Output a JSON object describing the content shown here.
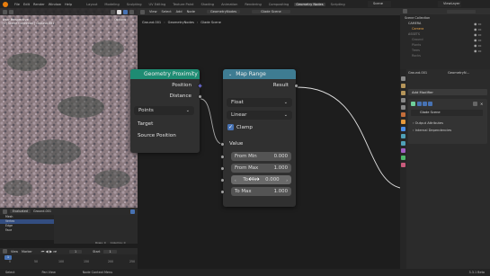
{
  "topbar": {
    "menus": [
      "File",
      "Edit",
      "Render",
      "Window",
      "Help"
    ],
    "workspaces": [
      "Layout",
      "Modeling",
      "Sculpting",
      "UV Editing",
      "Texture Paint",
      "Shading",
      "Animation",
      "Rendering",
      "Compositing",
      "Geometry Nodes",
      "Scripting"
    ],
    "active_workspace": "Geometry Nodes",
    "scene": "Scene",
    "view_layer": "ViewLayer"
  },
  "viewport": {
    "info_line1": "User Perspective",
    "info_line2": "(1) Scene Collection | Ground.001",
    "options": "Options"
  },
  "spreadsheet": {
    "mode": "Evaluated",
    "object": "Ground.001",
    "items": [
      "Mesh",
      "Vertex",
      "Edge",
      "Face"
    ],
    "rows": "Rows: 0",
    "columns": "Columns: 0"
  },
  "timeline": {
    "menus": [
      "View",
      "Marker"
    ],
    "frame": "1",
    "start_label": "Start",
    "start": "1",
    "ticks": [
      "0",
      "50",
      "100",
      "150",
      "200",
      "250"
    ]
  },
  "node_editor": {
    "menus": [
      "View",
      "Select",
      "Add",
      "Node"
    ],
    "object": "Ground.001",
    "modifier": "GeometryNodes",
    "tree": "Glade Scene",
    "breadcrumb": [
      "Ground.001",
      "GeometryNodes",
      "Glade Scene"
    ]
  },
  "node_geoprox": {
    "title": "Geometry Proximity",
    "outputs": [
      "Position",
      "Distance"
    ],
    "mode": "Points",
    "inputs": [
      "Target",
      "Source Position"
    ]
  },
  "node_maprange": {
    "title": "Map Range",
    "output": "Result",
    "data_type": "Float",
    "interpolation": "Linear",
    "clamp_label": "Clamp",
    "value_label": "Value",
    "fields": [
      {
        "label": "From Min",
        "value": "0.000"
      },
      {
        "label": "From Max",
        "value": "1.000"
      },
      {
        "label": "To Min",
        "value": "0.000"
      },
      {
        "label": "To Max",
        "value": "1.000"
      }
    ]
  },
  "outliner": {
    "title": "Scene Collection",
    "items": [
      "CAMERA",
      "Camera",
      "ASSETS",
      "Ground",
      "Plants",
      "Trees",
      "Rocks"
    ]
  },
  "properties": {
    "object": "Ground.001",
    "modifier_tab": "GeometryN...",
    "add_modifier": "Add Modifier",
    "modifier_name": "Glade Scene",
    "sections": [
      "Output Attributes",
      "Internal Dependencies"
    ]
  },
  "statusbar": {
    "items": [
      "Select",
      "Pan View",
      "Node Context Menu"
    ],
    "version": "3.3.1 Beta"
  },
  "colors": {
    "geo_header": "#1e8c73",
    "map_header": "#3e7c92",
    "accent": "#4772b3",
    "brand": "#e87d0d"
  }
}
